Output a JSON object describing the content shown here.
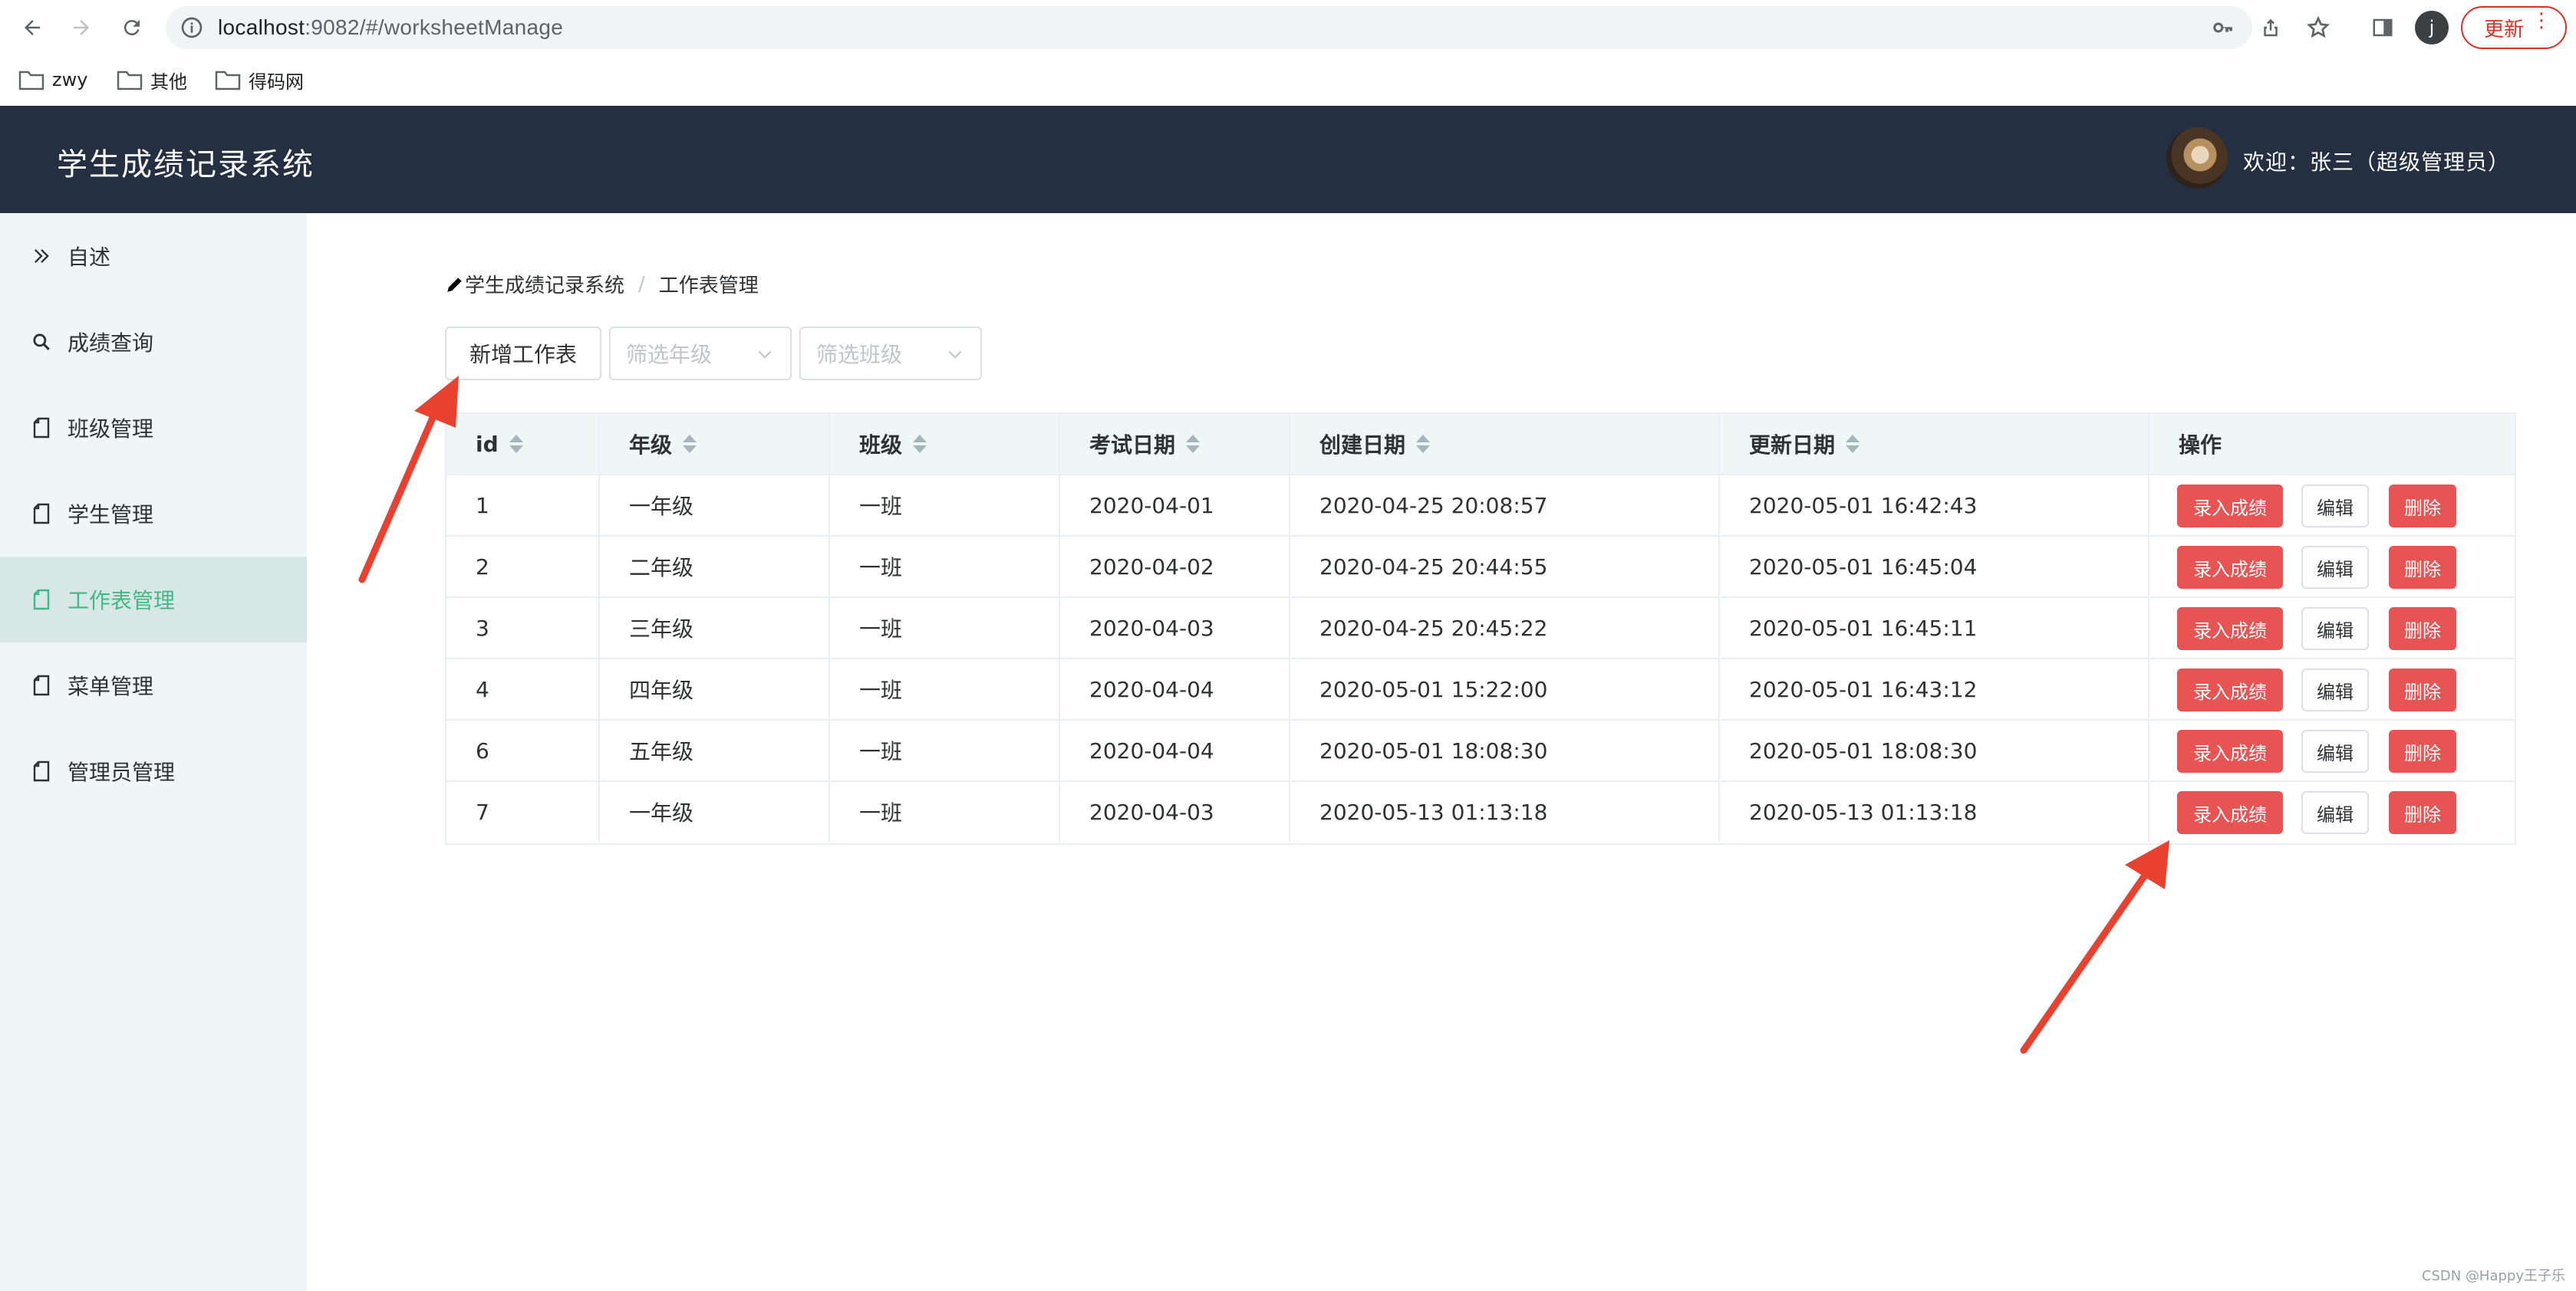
{
  "browser": {
    "url_host": "localhost",
    "url_rest": ":9082/#/worksheetManage",
    "profile_initial": "j",
    "update_label": "更新",
    "bookmarks": [
      "zwy",
      "其他",
      "得码网"
    ]
  },
  "header": {
    "title": "学生成绩记录系统",
    "user_label": "欢迎：张三（超级管理员）"
  },
  "sidebar": {
    "items": [
      {
        "label": "自述"
      },
      {
        "label": "成绩查询"
      },
      {
        "label": "班级管理"
      },
      {
        "label": "学生管理"
      },
      {
        "label": "工作表管理"
      },
      {
        "label": "菜单管理"
      },
      {
        "label": "管理员管理"
      }
    ],
    "active_index": 4
  },
  "breadcrumb": {
    "root": "学生成绩记录系统",
    "current": "工作表管理"
  },
  "toolbar": {
    "add_label": "新增工作表",
    "grade_placeholder": "筛选年级",
    "class_placeholder": "筛选班级"
  },
  "table": {
    "columns": [
      "id",
      "年级",
      "班级",
      "考试日期",
      "创建日期",
      "更新日期",
      "操作"
    ],
    "rows": [
      {
        "id": "1",
        "grade": "一年级",
        "class": "一班",
        "exam_date": "2020-04-01",
        "created": "2020-04-25 20:08:57",
        "updated": "2020-05-01 16:42:43"
      },
      {
        "id": "2",
        "grade": "二年级",
        "class": "一班",
        "exam_date": "2020-04-02",
        "created": "2020-04-25 20:44:55",
        "updated": "2020-05-01 16:45:04"
      },
      {
        "id": "3",
        "grade": "三年级",
        "class": "一班",
        "exam_date": "2020-04-03",
        "created": "2020-04-25 20:45:22",
        "updated": "2020-05-01 16:45:11"
      },
      {
        "id": "4",
        "grade": "四年级",
        "class": "一班",
        "exam_date": "2020-04-04",
        "created": "2020-05-01 15:22:00",
        "updated": "2020-05-01 16:43:12"
      },
      {
        "id": "6",
        "grade": "五年级",
        "class": "一班",
        "exam_date": "2020-04-04",
        "created": "2020-05-01 18:08:30",
        "updated": "2020-05-01 18:08:30"
      },
      {
        "id": "7",
        "grade": "一年级",
        "class": "一班",
        "exam_date": "2020-04-03",
        "created": "2020-05-13 01:13:18",
        "updated": "2020-05-13 01:13:18"
      }
    ],
    "actions": {
      "enter_scores": "录入成绩",
      "edit": "编辑",
      "delete": "删除"
    }
  },
  "watermark": "CSDN @Happy王子乐",
  "colors": {
    "header_bg": "#242f42",
    "sidebar_bg": "#eef6f6",
    "active": "#42b983",
    "danger": "#e85454",
    "annotation_arrow": "#e8412f"
  }
}
